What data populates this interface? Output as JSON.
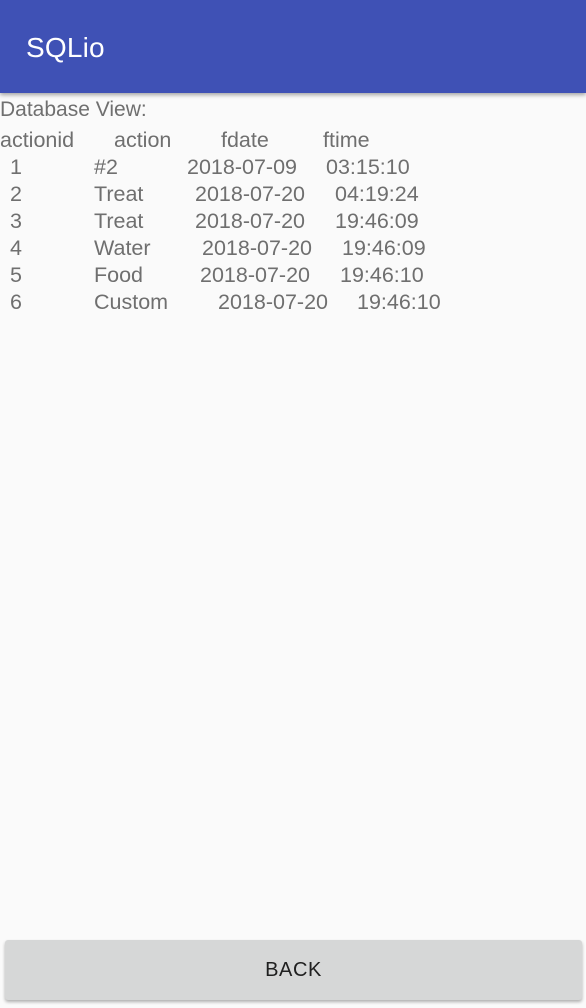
{
  "app": {
    "title": "SQLio"
  },
  "view": {
    "label": "Database View:",
    "columns": [
      "actionid",
      "action",
      "fdate",
      "ftime"
    ],
    "rows": [
      [
        "1",
        "#2",
        "2018-07-09",
        "03:15:10"
      ],
      [
        "2",
        "Treat",
        "2018-07-20",
        "04:19:24"
      ],
      [
        "3",
        "Treat",
        "2018-07-20",
        "19:46:09"
      ],
      [
        "4",
        "Water",
        "2018-07-20",
        "19:46:09"
      ],
      [
        "5",
        "Food",
        "2018-07-20",
        "19:46:10"
      ],
      [
        "6",
        "Custom",
        "2018-07-20",
        "19:46:10"
      ]
    ]
  },
  "footer": {
    "back_label": "BACK"
  }
}
